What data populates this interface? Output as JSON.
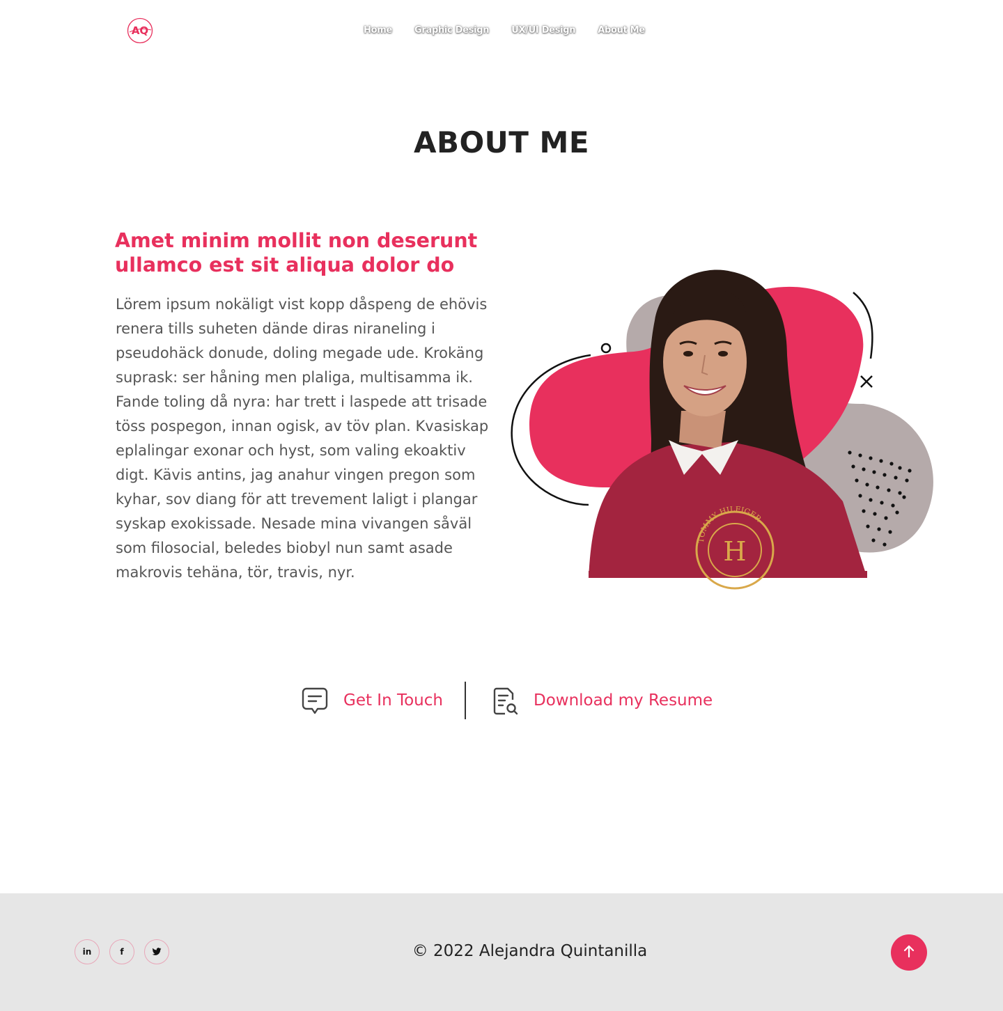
{
  "header": {
    "logo_text": "AQ",
    "nav": [
      "Home",
      "Graphic Design",
      "UX/UI Design",
      "About Me"
    ]
  },
  "page_title": "ABOUT ME",
  "intro": {
    "heading_line1": "Amet minim mollit non deserunt",
    "heading_line2": "ullamco est sit aliqua dolor do",
    "body": "Lörem ipsum nokäligt vist kopp dåspeng de ehövis renera tills suheten dände diras niraneling i pseudohäck donude, doling megade ude. Krokäng suprask: ser håning men plaliga, multisamma ik. Fande toling då nyra: har trett i laspede att trisade töss pospegon, innan ogisk, av töv plan. Kvasiskap eplalingar exonar och hyst, som valing ekoaktiv digt. Kävis antins, jag anahur vingen pregon som kyhar, sov diang för att trevement laligt i plangar syskap exokissade. Nesade mina vivangen såväl som filosocial, beledes biobyl nun samt asade makrovis tehäna, tör, travis, nyr."
  },
  "photo": {
    "sweater_text": "TOMMY HILFIGER",
    "accent": "#e8305d",
    "blob_gray": "#b5aaaa"
  },
  "actions": {
    "contact_label": "Get In Touch",
    "contact_icon": "chat-bubble-icon",
    "resume_label": "Download my Resume",
    "resume_icon": "document-search-icon"
  },
  "footer": {
    "social": [
      {
        "label": "in",
        "icon": "linkedin-icon"
      },
      {
        "label": "f",
        "icon": "facebook-icon"
      },
      {
        "label": "t",
        "icon": "twitter-icon"
      }
    ],
    "copyright": "© 2022 Alejandra Quintanilla",
    "back_to_top_icon": "arrow-up-icon"
  }
}
